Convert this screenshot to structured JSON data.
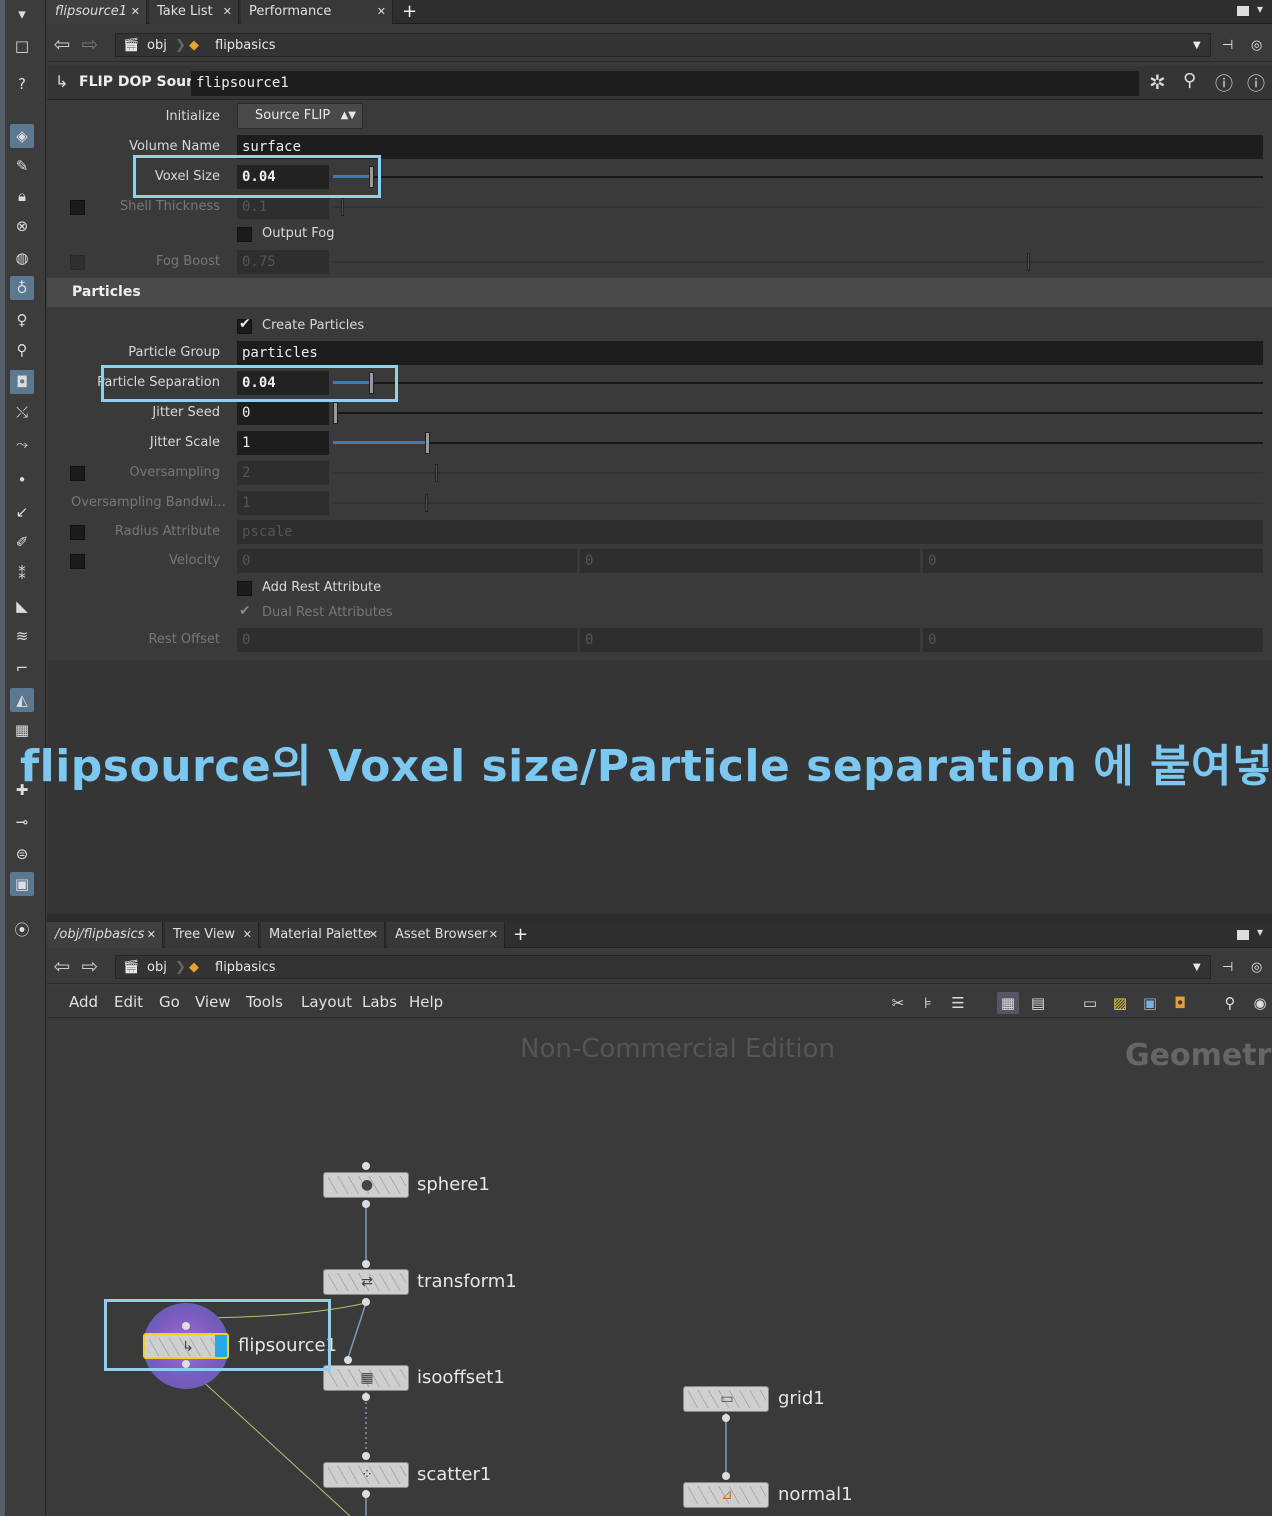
{
  "top_tabs": [
    {
      "label": "flipsource1"
    },
    {
      "label": "Take List"
    },
    {
      "label": "Performance Monitor"
    }
  ],
  "top_path": {
    "root": "obj",
    "current": "flipbasics"
  },
  "node_header": {
    "type": "FLIP DOP Source",
    "name": "flipsource1"
  },
  "params": {
    "initialize_label": "Initialize",
    "initialize_value": "Source FLIP",
    "volume_name_label": "Volume Name",
    "volume_name_value": "surface",
    "voxel_size_label": "Voxel Size",
    "voxel_size_value": "0.04",
    "shell_thickness_label": "Shell Thickness",
    "shell_thickness_value": "0.1",
    "output_fog_label": "Output Fog",
    "fog_boost_label": "Fog Boost",
    "fog_boost_value": "0.75",
    "particles_section": "Particles",
    "create_particles_label": "Create Particles",
    "particle_group_label": "Particle Group",
    "particle_group_value": "particles",
    "particle_sep_label": "Particle Separation",
    "particle_sep_value": "0.04",
    "jitter_seed_label": "Jitter Seed",
    "jitter_seed_value": "0",
    "jitter_scale_label": "Jitter Scale",
    "jitter_scale_value": "1",
    "oversampling_label": "Oversampling",
    "oversampling_value": "2",
    "oversampling_bw_label": "Oversampling Bandwi...",
    "oversampling_bw_value": "1",
    "radius_attr_label": "Radius Attribute",
    "radius_attr_value": "pscale",
    "velocity_label": "Velocity",
    "velocity_values": [
      "0",
      "0",
      "0"
    ],
    "add_rest_label": "Add Rest Attribute",
    "dual_rest_label": "Dual Rest Attributes",
    "rest_offset_label": "Rest Offset",
    "rest_offset_values": [
      "0",
      "0",
      "0"
    ]
  },
  "annotation": "flipsource의 Voxel size/Particle separation 에 붙여넣기",
  "bottom_tabs": [
    {
      "label": "/obj/flipbasics"
    },
    {
      "label": "Tree View"
    },
    {
      "label": "Material Palette"
    },
    {
      "label": "Asset Browser"
    }
  ],
  "bottom_path": {
    "root": "obj",
    "current": "flipbasics"
  },
  "menu": [
    "Add",
    "Edit",
    "Go",
    "View",
    "Tools",
    "Layout",
    "Labs",
    "Help"
  ],
  "network": {
    "watermark": "Non-Commercial Edition",
    "context": "Geometry",
    "nodes": {
      "sphere": "sphere1",
      "transform": "transform1",
      "flipsource": "flipsource1",
      "isooffset": "isooffset1",
      "scatter": "scatter1",
      "grid": "grid1",
      "normal": "normal1"
    }
  },
  "colors": {
    "highlight": "#8fd0f0",
    "slider_fill": "#3f78b8",
    "annotation": "#7cc8f0"
  }
}
